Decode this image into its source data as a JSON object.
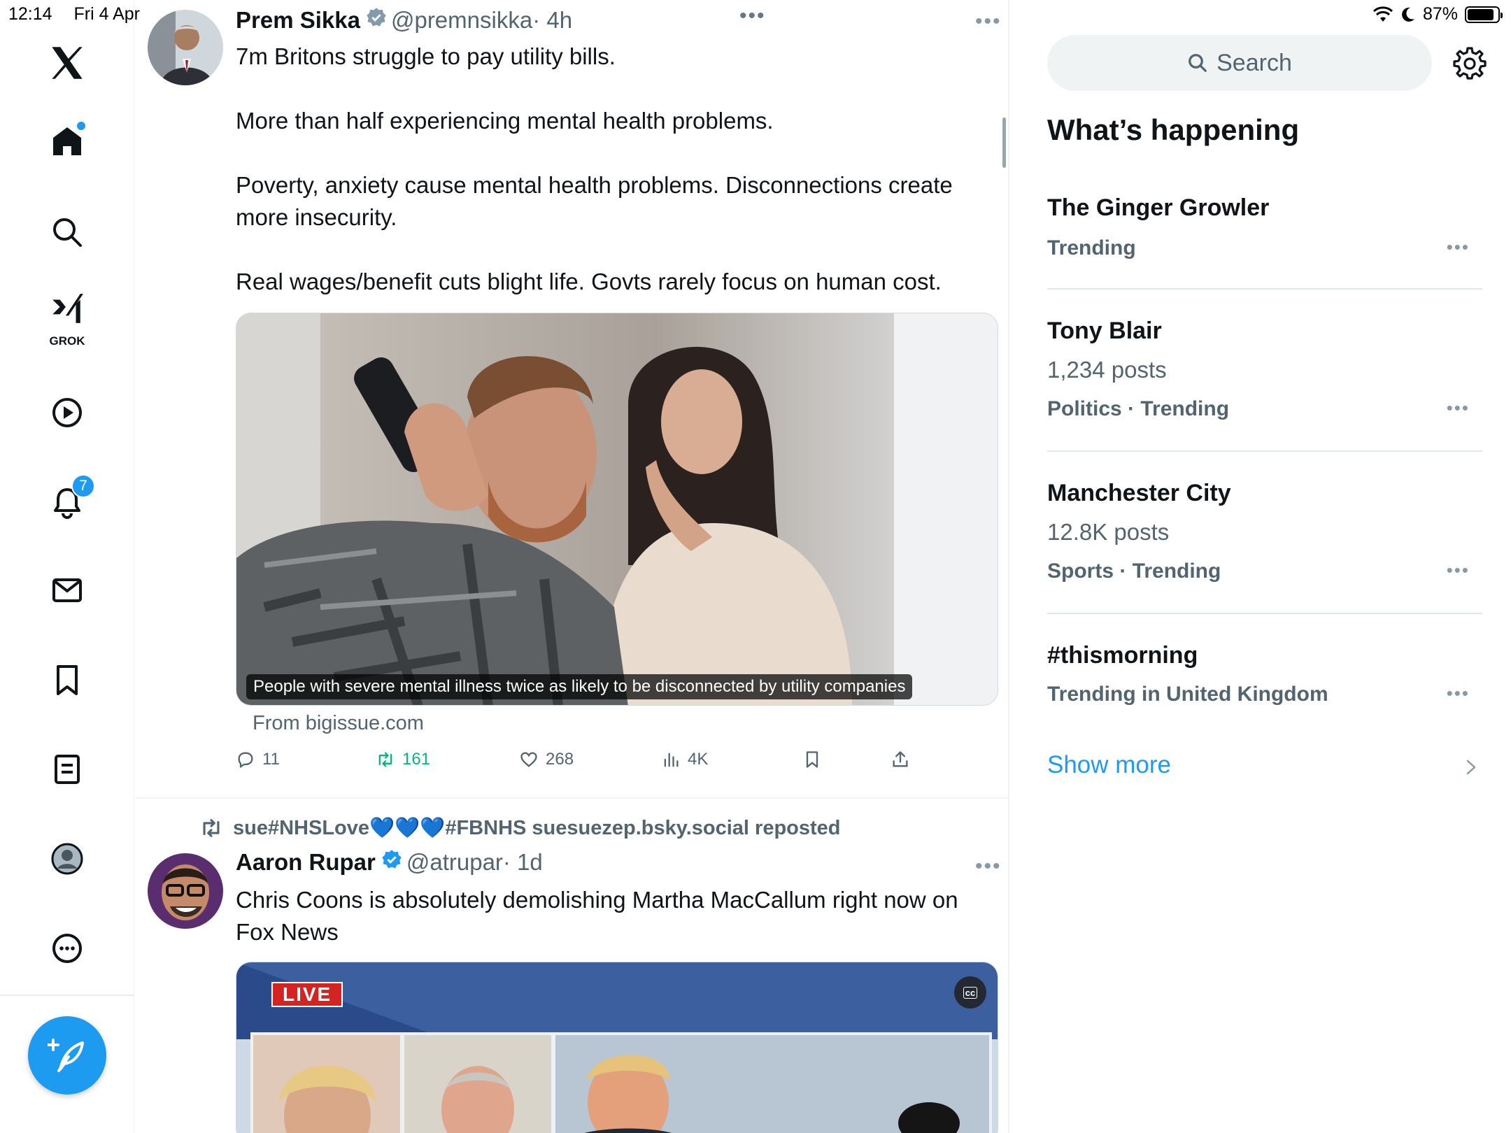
{
  "status_bar": {
    "time": "12:14",
    "date": "Fri 4 Apr",
    "battery": "87%",
    "battery_level": 0.87
  },
  "nav": {
    "items": [
      "home",
      "explore",
      "grok",
      "video",
      "notifications",
      "messages",
      "bookmarks",
      "lists",
      "profile",
      "more"
    ],
    "grok_label": "GROK",
    "notifications_badge": "7"
  },
  "timeline": {
    "tweets": [
      {
        "name": "Prem Sikka",
        "handle": "@premnsikka",
        "time": "· 4h",
        "text": "7m Britons struggle to pay utility bills.\n\nMore than half experiencing  mental health problems.\n\nPoverty, anxiety cause mental health problems. Disconnections create more insecurity.\n\nReal wages/benefit cuts blight life. Govts rarely focus on human cost.",
        "card": {
          "caption": "People with severe mental illness twice as likely to be disconnected by utility companies",
          "source": "From bigissue.com"
        },
        "actions": {
          "replies": "11",
          "reposts": "161",
          "likes": "268",
          "views": "4K"
        }
      },
      {
        "repost_by": "sue#NHSLove💙💙💙#FBNHS suesuezep.bsky.social reposted",
        "name": "Aaron Rupar",
        "handle": "@atrupar",
        "time": "· 1d",
        "text": "Chris Coons is absolutely demolishing Martha MacCallum right now on Fox News",
        "media": {
          "live_label": "LIVE",
          "cc_label": "cc"
        }
      }
    ]
  },
  "sidebar": {
    "search_placeholder": "Search",
    "section_title": "What’s happening",
    "trends": [
      {
        "name": "The Ginger Growler",
        "count": "",
        "meta": "Trending"
      },
      {
        "name": "Tony Blair",
        "count": "1,234 posts",
        "meta": "Politics · Trending"
      },
      {
        "name": "Manchester City",
        "count": "12.8K posts",
        "meta": "Sports · Trending"
      },
      {
        "name": "#thismorning",
        "count": "",
        "meta": "Trending in United Kingdom"
      }
    ],
    "show_more": "Show more"
  },
  "colors": {
    "accent": "#1d9bf0",
    "repost_green": "#00ba7c",
    "secondary_text": "#536471"
  }
}
